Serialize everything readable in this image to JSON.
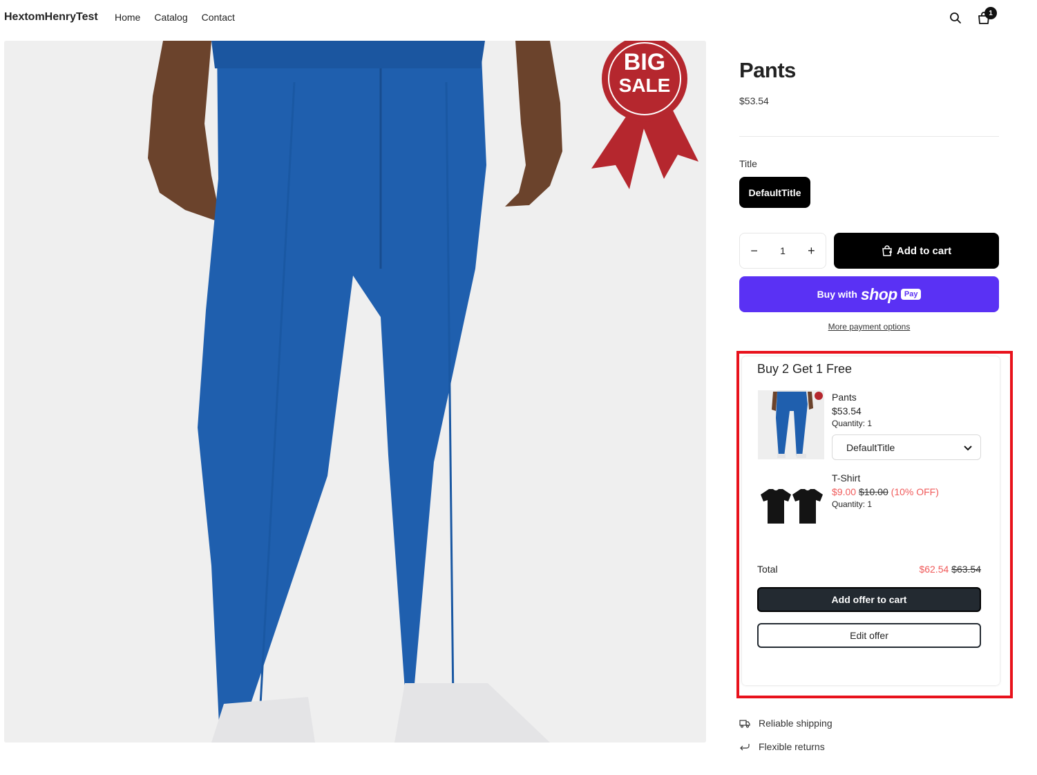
{
  "header": {
    "brand": "HextomHenryTest",
    "nav": [
      "Home",
      "Catalog",
      "Contact"
    ],
    "cart_count": "1"
  },
  "product": {
    "title": "Pants",
    "price": "$53.54",
    "image_badge": [
      "BIG",
      "SALE"
    ],
    "variant_label": "Title",
    "variant_selected": "DefaultTitle",
    "quantity": "1",
    "add_to_cart": "Add to cart",
    "shop_pay": {
      "prefix": "Buy with",
      "brand": "shop",
      "pay": "Pay"
    },
    "more_payment": "More payment options"
  },
  "offer": {
    "title": "Buy 2 Get 1 Free",
    "items": [
      {
        "name": "Pants",
        "price": "$53.54",
        "quantity": "Quantity: 1",
        "variant": "DefaultTitle"
      },
      {
        "name": "T-Shirt",
        "sale_price": "$9.00",
        "original_price": "$10.00",
        "discount": "(10% OFF)",
        "quantity": "Quantity: 1"
      }
    ],
    "total_label": "Total",
    "total_sale": "$62.54",
    "total_original": "$63.54",
    "add_button": "Add offer to cart",
    "edit_button": "Edit offer"
  },
  "features": [
    "Reliable shipping",
    "Flexible returns"
  ],
  "colors": {
    "offer_highlight": "#e8121c",
    "shop_pay": "#5a31f4",
    "sale_red": "#f05a5a",
    "pants_blue": "#1f5fae"
  }
}
